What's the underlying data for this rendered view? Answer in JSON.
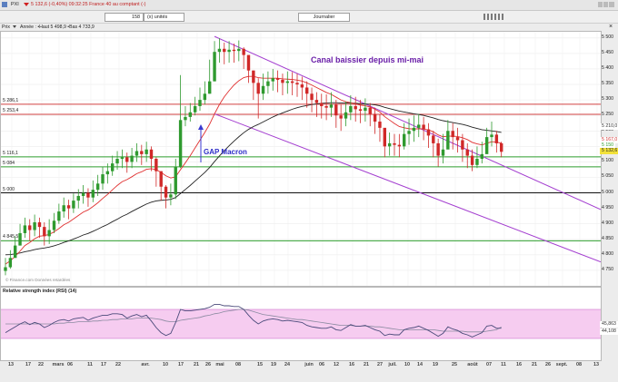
{
  "header": {
    "ticker": "PXI",
    "quote": "5 132,6 (-0,40%) 09:32:25 France 40 au comptant (-)"
  },
  "toolbar": {
    "period_value": "158",
    "period_unit": "(x) unités",
    "timeframe": "Journalier"
  },
  "info": {
    "mode": "Prix",
    "stats": "Année : •Haut 5 498,9 •Bas 4 733,9"
  },
  "annotations": {
    "channel": "Canal baissier depuis mi-mai",
    "gap": "GAP Macron",
    "source": "© Finance.com Données retardées"
  },
  "levels": [
    {
      "value": 5286.1,
      "label": "5 286,1",
      "color": "#d04040"
    },
    {
      "value": 5253.4,
      "label": "5 253,4",
      "color": "#d04040"
    },
    {
      "value": 5116.1,
      "label": "5 116,1",
      "color": "#2e9e2e"
    },
    {
      "value": 5084,
      "label": "5 084",
      "color": "#2e9e2e"
    },
    {
      "value": 5000,
      "label": "5 000",
      "color": "#111111"
    },
    {
      "value": 4845.5,
      "label": "4 845,5",
      "color": "#2e9e2e"
    }
  ],
  "price_tags": [
    {
      "value": 5210,
      "label": "5 210,0",
      "bg": "#ffffff",
      "fg": "#333333"
    },
    {
      "value": 5167,
      "label": "5 167,0",
      "bg": "#ffffff",
      "fg": "#d03030"
    },
    {
      "value": 5150,
      "label": "5 150",
      "bg": "#ffffff",
      "fg": "#2e9e2e"
    },
    {
      "value": 5132.6,
      "label": "5 132,6",
      "bg": "#f3e23a",
      "fg": "#222222"
    }
  ],
  "rsi": {
    "title": "Relative strength index (RSI) (14)",
    "values": [
      45.863,
      44.108
    ],
    "labels": [
      "45,863",
      "44,108"
    ]
  },
  "chart_data": {
    "type": "candlestick",
    "title": "",
    "ylim": [
      4700,
      5520
    ],
    "yticks": [
      4750,
      4800,
      4850,
      4900,
      4950,
      5000,
      5050,
      5100,
      5150,
      5200,
      5250,
      5300,
      5350,
      5400,
      5450,
      5500
    ],
    "ytick_labels": [
      "4 750",
      "4 800",
      "4 850",
      "4 900",
      "4 950",
      "5 000",
      "5 050",
      "5 100",
      "5 150",
      "5 200",
      "5 250",
      "5 300",
      "5 350",
      "5 400",
      "5 450",
      "5 500"
    ],
    "xtick_labels": [
      "13",
      "17",
      "22",
      "mars",
      "06",
      "11",
      "17",
      "22",
      "avr.",
      "10",
      "17",
      "21",
      "26",
      "mai",
      "08",
      "15",
      "19",
      "24",
      "juin",
      "06",
      "12",
      "16",
      "21",
      "27",
      "juil.",
      "10",
      "14",
      "19",
      "25",
      "août",
      "07",
      "11",
      "16",
      "21",
      "26",
      "sept.",
      "08",
      "13"
    ],
    "close": [
      4760,
      4790,
      4830,
      4870,
      4895,
      4880,
      4905,
      4890,
      4860,
      4880,
      4910,
      4940,
      4960,
      4950,
      4975,
      4990,
      5000,
      4985,
      5010,
      5030,
      5060,
      5070,
      5095,
      5110,
      5115,
      5100,
      5120,
      5135,
      5125,
      5140,
      5110,
      5070,
      5020,
      4985,
      4995,
      5085,
      5235,
      5245,
      5260,
      5280,
      5300,
      5320,
      5360,
      5455,
      5465,
      5455,
      5462,
      5458,
      5465,
      5445,
      5395,
      5355,
      5320,
      5345,
      5360,
      5370,
      5365,
      5355,
      5360,
      5355,
      5350,
      5340,
      5320,
      5300,
      5290,
      5280,
      5275,
      5285,
      5250,
      5240,
      5260,
      5280,
      5270,
      5265,
      5275,
      5255,
      5230,
      5210,
      5150,
      5160,
      5155,
      5150,
      5190,
      5200,
      5210,
      5220,
      5205,
      5185,
      5160,
      5120,
      5140,
      5200,
      5180,
      5170,
      5140,
      5120,
      5090,
      5110,
      5125,
      5180,
      5188,
      5160,
      5132.6
    ],
    "high": [
      4790,
      4815,
      4860,
      4900,
      4920,
      4915,
      4930,
      4920,
      4905,
      4915,
      4935,
      4965,
      4985,
      4978,
      4998,
      5012,
      5025,
      5015,
      5040,
      5058,
      5085,
      5095,
      5120,
      5135,
      5140,
      5130,
      5145,
      5160,
      5155,
      5165,
      5150,
      5115,
      5070,
      5025,
      5030,
      5110,
      5380,
      5280,
      5290,
      5310,
      5340,
      5360,
      5430,
      5490,
      5498.9,
      5485,
      5490,
      5482,
      5492,
      5470,
      5440,
      5395,
      5370,
      5385,
      5392,
      5400,
      5395,
      5385,
      5392,
      5390,
      5385,
      5375,
      5360,
      5340,
      5325,
      5320,
      5318,
      5325,
      5300,
      5285,
      5295,
      5315,
      5310,
      5300,
      5305,
      5290,
      5275,
      5255,
      5200,
      5195,
      5190,
      5190,
      5225,
      5240,
      5250,
      5255,
      5245,
      5225,
      5200,
      5175,
      5190,
      5235,
      5225,
      5210,
      5190,
      5160,
      5140,
      5150,
      5165,
      5210,
      5230,
      5200,
      5165
    ],
    "low": [
      4733.9,
      4755,
      4795,
      4830,
      4855,
      4845,
      4860,
      4855,
      4830,
      4835,
      4870,
      4900,
      4920,
      4915,
      4935,
      4950,
      4965,
      4955,
      4970,
      4990,
      5010,
      5030,
      5055,
      5075,
      5080,
      5065,
      5080,
      5100,
      5090,
      5100,
      5070,
      5020,
      4975,
      4950,
      4960,
      4980,
      5080,
      5215,
      5230,
      5250,
      5265,
      5285,
      5320,
      5360,
      5420,
      5415,
      5420,
      5420,
      5425,
      5400,
      5355,
      5300,
      5240,
      5300,
      5320,
      5330,
      5325,
      5315,
      5320,
      5315,
      5310,
      5300,
      5275,
      5260,
      5245,
      5240,
      5235,
      5245,
      5210,
      5200,
      5215,
      5235,
      5230,
      5225,
      5230,
      5215,
      5190,
      5165,
      5115,
      5120,
      5120,
      5115,
      5140,
      5155,
      5165,
      5180,
      5170,
      5145,
      5115,
      5085,
      5095,
      5150,
      5140,
      5130,
      5100,
      5080,
      5070,
      5080,
      5095,
      5130,
      5150,
      5130,
      5115
    ],
    "ma_red": [
      4770,
      4781,
      4795,
      4812,
      4830,
      4840,
      4852,
      4860,
      4862,
      4866,
      4874,
      4885,
      4897,
      4905,
      4916,
      4927,
      4938,
      4945,
      4956,
      4968,
      4982,
      4995,
      5010,
      5024,
      5036,
      5043,
      5052,
      5062,
      5068,
      5076,
      5078,
      5075,
      5066,
      5055,
      5048,
      5052,
      5075,
      5097,
      5120,
      5145,
      5170,
      5195,
      5222,
      5255,
      5285,
      5310,
      5330,
      5348,
      5362,
      5372,
      5376,
      5376,
      5372,
      5370,
      5370,
      5370,
      5370,
      5368,
      5367,
      5366,
      5364,
      5361,
      5355,
      5348,
      5340,
      5332,
      5324,
      5318,
      5309,
      5300,
      5294,
      5291,
      5287,
      5283,
      5281,
      5277,
      5270,
      5261,
      5246,
      5235,
      5224,
      5214,
      5210,
      5207,
      5206,
      5207,
      5206,
      5203,
      5197,
      5187,
      5181,
      5183,
      5183,
      5182,
      5178,
      5172,
      5163,
      5158,
      5155,
      5160,
      5165,
      5164,
      5160
    ],
    "ma_black": [
      4800,
      4801,
      4803,
      4806,
      4810,
      4813,
      4817,
      4820,
      4822,
      4825,
      4829,
      4834,
      4840,
      4845,
      4851,
      4857,
      4864,
      4869,
      4876,
      4883,
      4891,
      4898,
      4907,
      4915,
      4924,
      4931,
      4940,
      4948,
      4956,
      4964,
      4970,
      4974,
      4976,
      4977,
      4979,
      4985,
      4998,
      5011,
      5024,
      5038,
      5052,
      5066,
      5082,
      5101,
      5119,
      5136,
      5152,
      5167,
      5181,
      5194,
      5205,
      5214,
      5221,
      5229,
      5237,
      5245,
      5252,
      5258,
      5264,
      5270,
      5275,
      5279,
      5282,
      5285,
      5287,
      5289,
      5290,
      5291,
      5291,
      5290,
      5290,
      5290,
      5289,
      5288,
      5287,
      5286,
      5284,
      5281,
      5276,
      5272,
      5268,
      5264,
      5261,
      5258,
      5255,
      5253,
      5250,
      5246,
      5242,
      5237,
      5233,
      5230,
      5227,
      5224,
      5221,
      5217,
      5212,
      5208,
      5204,
      5202,
      5200,
      5198,
      5195
    ],
    "channel_upper": [
      [
        43,
        5505
      ],
      [
        102,
        5090
      ]
    ],
    "channel_lower": [
      [
        43,
        5255
      ],
      [
        102,
        4900
      ]
    ],
    "rsi_ylim": [
      0,
      100
    ],
    "rsi_levels": [
      30,
      70
    ],
    "rsi_values": [
      38,
      42,
      46,
      50,
      53,
      49,
      52,
      50,
      45,
      48,
      52,
      55,
      56,
      54,
      57,
      58,
      59,
      55,
      58,
      60,
      62,
      62,
      64,
      64,
      63,
      58,
      61,
      63,
      60,
      62,
      54,
      45,
      38,
      34,
      37,
      52,
      70,
      68,
      68,
      69,
      70,
      71,
      73,
      77,
      77,
      75,
      75,
      74,
      74,
      70,
      62,
      55,
      50,
      54,
      56,
      57,
      56,
      54,
      55,
      54,
      53,
      52,
      48,
      46,
      45,
      44,
      44,
      46,
      42,
      41,
      45,
      49,
      47,
      47,
      48,
      45,
      42,
      40,
      34,
      36,
      35,
      35,
      42,
      44,
      45,
      47,
      44,
      41,
      37,
      33,
      37,
      46,
      43,
      41,
      37,
      35,
      32,
      35,
      38,
      47,
      48,
      44,
      44.108
    ],
    "rsi_signal": [
      50,
      50,
      50,
      50,
      50,
      50,
      50,
      50,
      50,
      50,
      50,
      51,
      51,
      52,
      52,
      53,
      53,
      53,
      54,
      54,
      55,
      55,
      56,
      56,
      57,
      57,
      57,
      58,
      58,
      58,
      58,
      57,
      56,
      54,
      53,
      53,
      55,
      56,
      57,
      58,
      59,
      61,
      62,
      64,
      65,
      67,
      68,
      69,
      70,
      70,
      69,
      67,
      65,
      63,
      62,
      61,
      60,
      59,
      58,
      57,
      56,
      56,
      55,
      54,
      53,
      52,
      51,
      50,
      49,
      48,
      48,
      48,
      47,
      47,
      47,
      47,
      46,
      46,
      45,
      44,
      43,
      42,
      42,
      42,
      42,
      42,
      42,
      42,
      42,
      41,
      40,
      40,
      40,
      40,
      40,
      39,
      39,
      39,
      39,
      40,
      41,
      42,
      45.863
    ]
  }
}
